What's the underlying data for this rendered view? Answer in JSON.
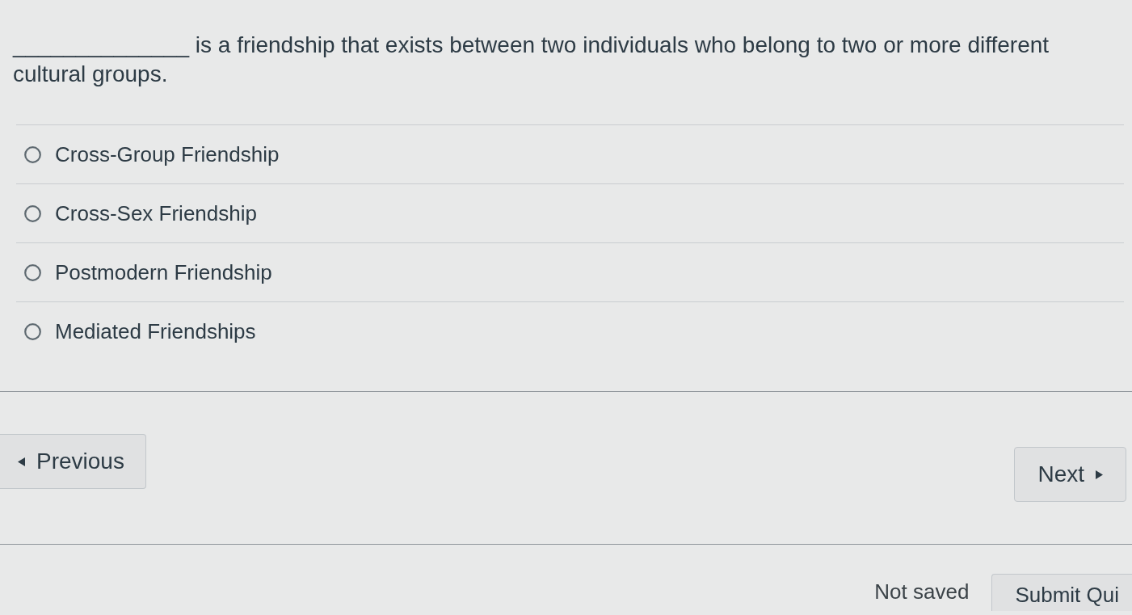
{
  "question": {
    "text": "______________ is a friendship that exists between two individuals who belong to two or more different cultural groups."
  },
  "answers": [
    {
      "label": "Cross-Group Friendship",
      "selected": false
    },
    {
      "label": "Cross-Sex Friendship",
      "selected": false
    },
    {
      "label": "Postmodern Friendship",
      "selected": false
    },
    {
      "label": "Mediated Friendships",
      "selected": false
    }
  ],
  "navigation": {
    "previous": "Previous",
    "next": "Next"
  },
  "footer": {
    "save_status": "Not saved",
    "submit": "Submit Qui"
  }
}
